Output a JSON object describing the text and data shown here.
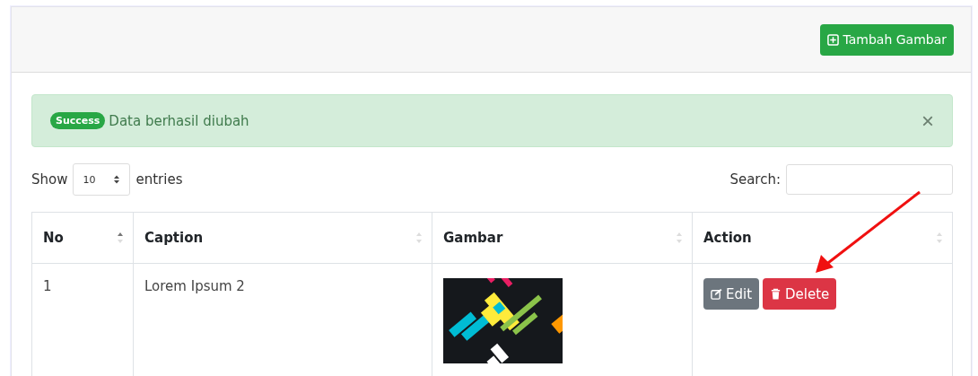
{
  "header": {
    "add_button": "Tambah Gambar"
  },
  "alert": {
    "badge": "Success",
    "message": "Data berhasil diubah",
    "close": "×"
  },
  "length": {
    "before": "Show",
    "value": "10",
    "after": "entries"
  },
  "search": {
    "label": "Search:"
  },
  "table": {
    "columns": [
      {
        "label": "No",
        "sorted": true
      },
      {
        "label": "Caption",
        "sorted": false
      },
      {
        "label": "Gambar",
        "sorted": false
      },
      {
        "label": "Action",
        "sorted": false
      }
    ],
    "rows": [
      {
        "no": "1",
        "caption": "Lorem Ipsum 2",
        "actions": [
          {
            "kind": "edit",
            "label": "Edit"
          },
          {
            "kind": "delete",
            "label": "Delete"
          }
        ]
      }
    ]
  }
}
